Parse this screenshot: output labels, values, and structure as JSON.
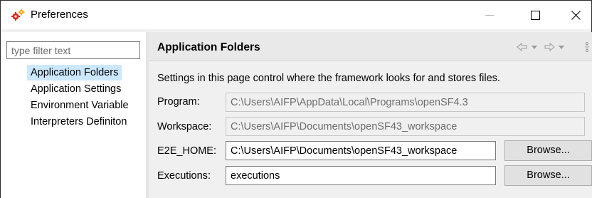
{
  "window": {
    "title": "Preferences",
    "icons": {
      "app": "gears-icon",
      "minimize": "minimize-icon",
      "maximize": "maximize-icon",
      "close": "close-icon"
    },
    "close_glyph": "✕"
  },
  "sidebar": {
    "filter_placeholder": "type filter text",
    "items": [
      {
        "label": "Application Folders",
        "selected": true
      },
      {
        "label": "Application Settings",
        "selected": false
      },
      {
        "label": "Environment Variable",
        "selected": false
      },
      {
        "label": "Interpreters Definiton",
        "selected": false
      }
    ]
  },
  "page": {
    "title": "Application Folders",
    "description": "Settings in this page control where the framework looks for and stores files.",
    "nav_icons": [
      "back-arrow-icon",
      "dropdown-icon",
      "forward-arrow-icon",
      "dropdown-icon",
      "menu-icon"
    ],
    "fields": {
      "program": {
        "label": "Program:",
        "value": "C:\\Users\\AIFP\\AppData\\Local\\Programs\\openSF4.3",
        "enabled": false
      },
      "workspace": {
        "label": "Workspace:",
        "value": "C:\\Users\\AIFP\\Documents\\openSF43_workspace",
        "enabled": false
      },
      "e2e_home": {
        "label": "E2E_HOME:",
        "value": "C:\\Users\\AIFP\\Documents\\openSF43_workspace",
        "enabled": true,
        "button": "Browse..."
      },
      "executions": {
        "label": "Executions:",
        "value": "executions",
        "enabled": true,
        "button": "Browse..."
      }
    }
  },
  "colors": {
    "selection": "#cce8ff",
    "header_bg": "#e9e9e9",
    "pane_bg": "#f0f0f0",
    "icon_orange": "#e8820c",
    "icon_red": "#d62d20"
  }
}
